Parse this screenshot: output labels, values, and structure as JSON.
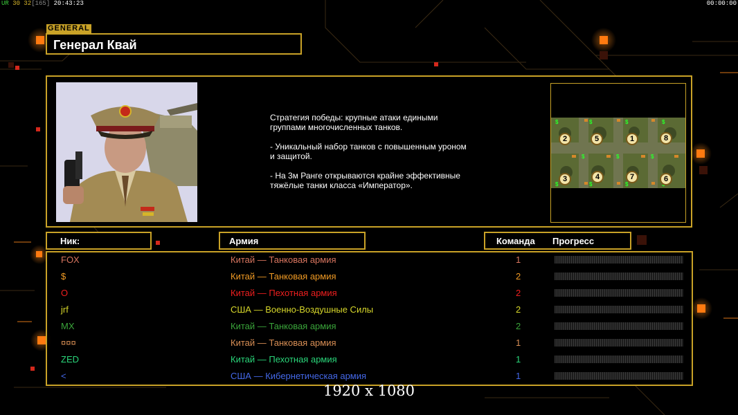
{
  "top_bar": {
    "ur_label": "UR",
    "ur_values": "30 32",
    "fps": "[165]",
    "clock": "20:43:23",
    "timer": "00:00:00"
  },
  "general": {
    "tag": "GENERAL",
    "name": "Генерал Квай",
    "description": "Стратегия победы: крупные атаки едиными\n группами многочисленных танков.\n\n- Уникальный набор танков с повышенным уроном\n и защитой.\n\n- На 3м Ранге открываются крайне эффективные\n тяжёлые танки класса «Император»."
  },
  "minimap": {
    "slots": [
      "2",
      "5",
      "1",
      "8",
      "3",
      "4",
      "7",
      "6"
    ]
  },
  "columns": {
    "nick": "Ник:",
    "army": "Армия",
    "team": "Команда",
    "progress": "Прогресс"
  },
  "players": [
    {
      "nick": "FOX",
      "army": "Китай — Танковая армия",
      "team": "1",
      "color": "#d8755f"
    },
    {
      "nick": "$",
      "army": "Китай — Танковая армия",
      "team": "2",
      "color": "#f09a24"
    },
    {
      "nick": "O",
      "army": "Китай — Пехотная армия",
      "team": "2",
      "color": "#ef1f1f"
    },
    {
      "nick": "jrf",
      "army": "США — Военно-Воздушные Силы",
      "team": "2",
      "color": "#d6d62a"
    },
    {
      "nick": "MX",
      "army": "Китай — Танковая армия",
      "team": "2",
      "color": "#3aa53a"
    },
    {
      "nick": "¤¤¤",
      "army": "Китай — Танковая армия",
      "team": "1",
      "color": "#d98f55"
    },
    {
      "nick": "ZED",
      "army": "Китай — Пехотная армия",
      "team": "1",
      "color": "#2ad67a"
    },
    {
      "nick": "<",
      "army": "США — Кибернетическая армия",
      "team": "1",
      "color": "#4468e8"
    }
  ],
  "resolution_label": "1920 x 1080"
}
